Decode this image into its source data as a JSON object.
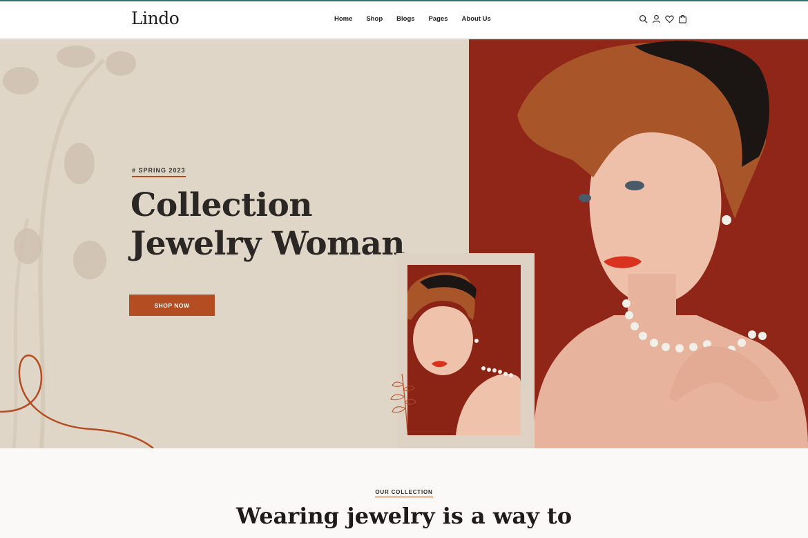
{
  "brand": {
    "logo": "Lindo"
  },
  "nav": {
    "items": [
      "Home",
      "Shop",
      "Blogs",
      "Pages",
      "About Us"
    ]
  },
  "header_icons": [
    "search-icon",
    "user-icon",
    "heart-icon",
    "cart-icon"
  ],
  "hero": {
    "eyebrow": "# SPRING 2023",
    "title_line1": "Collection",
    "title_line2": "Jewelry Woman",
    "cta_label": "SHOP NOW"
  },
  "collection": {
    "eyebrow": "OUR COLLECTION",
    "title": "Wearing jewelry is a way to"
  },
  "colors": {
    "accent": "#b54d22",
    "hero_bg": "#e0d6c8",
    "photo_bg": "#8f2617",
    "topline": "#2e6f7c"
  }
}
